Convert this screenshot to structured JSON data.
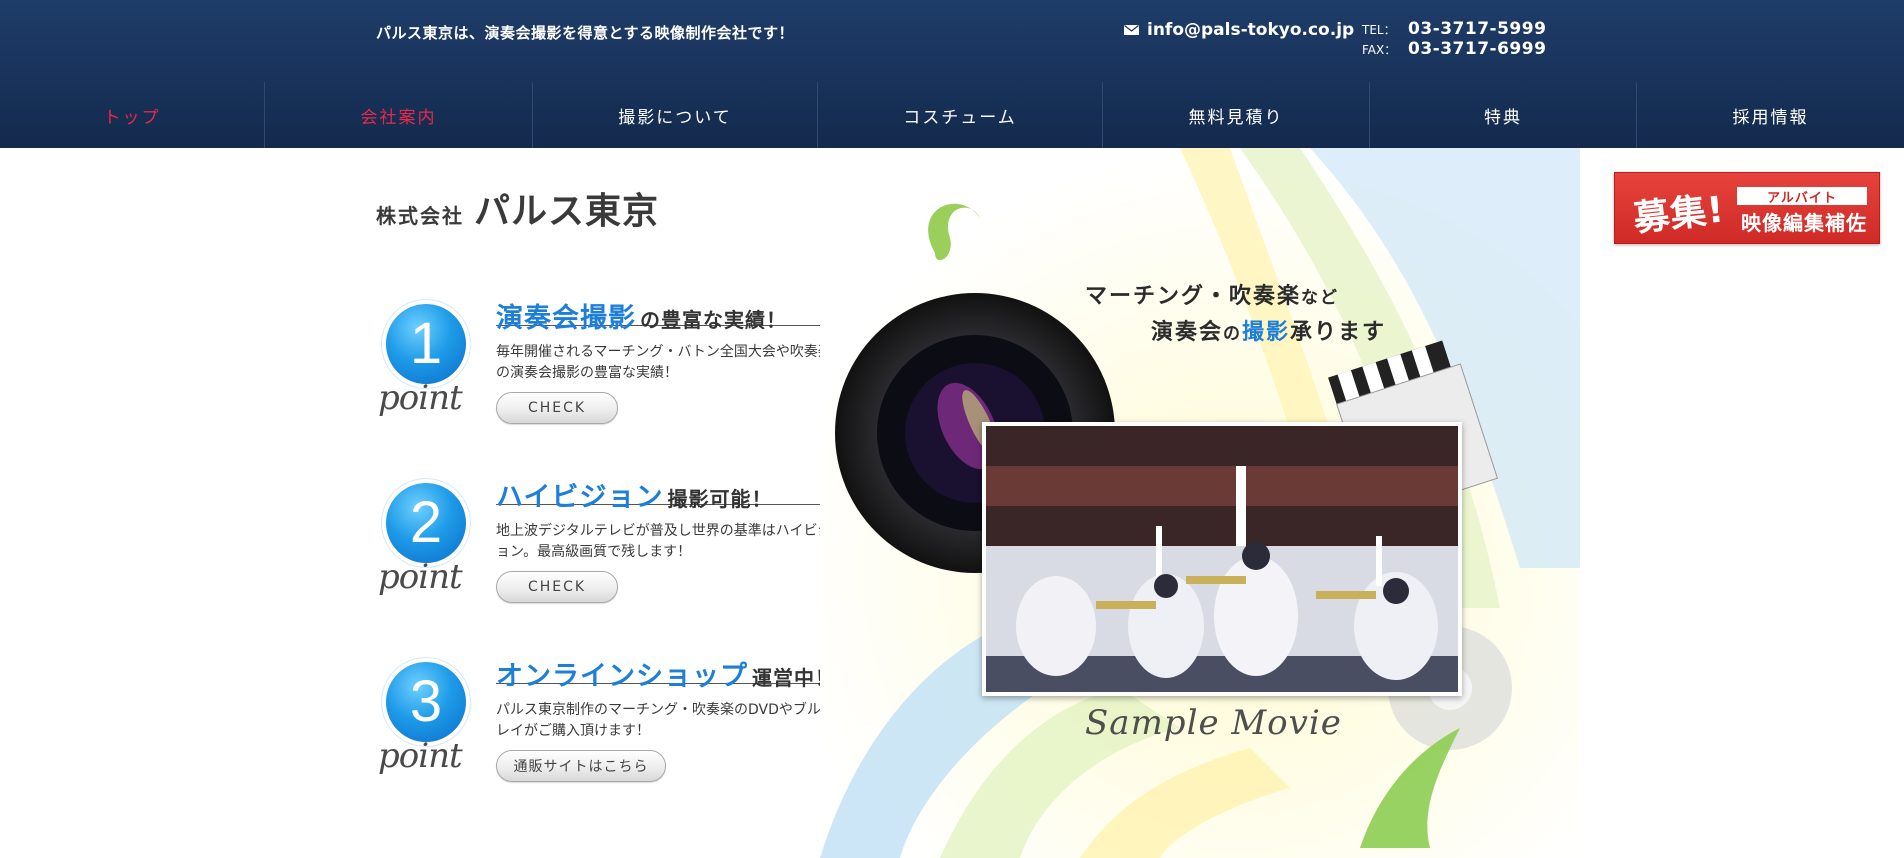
{
  "header": {
    "tagline": "パルス東京は、演奏会撮影を得意とする映像制作会社です！",
    "email": "info@pals-tokyo.co.jp",
    "tel_label": "TEL：",
    "tel": "03-3717-5999",
    "fax_label": "FAX：",
    "fax": "03-3717-6999",
    "icons": [
      "mail-icon"
    ]
  },
  "nav": {
    "items": [
      {
        "label": "トップ",
        "active": true
      },
      {
        "label": "会社案内",
        "active": true
      },
      {
        "label": "撮影について",
        "active": false
      },
      {
        "label": "コスチューム",
        "active": false
      },
      {
        "label": "無料見積り",
        "active": false
      },
      {
        "label": "特典",
        "active": false
      },
      {
        "label": "採用情報",
        "active": false
      }
    ],
    "active_color": "#e8284a"
  },
  "logo": {
    "small": "株式会社",
    "big": "パルス東京"
  },
  "points": [
    {
      "number": "1",
      "script": "point",
      "title_accent": "演奏会撮影",
      "title_rest": "の豊富な実績！",
      "desc": "毎年開催されるマーチング・バトン全国大会や吹奏楽の演奏会撮影の豊富な実績！",
      "button": "CHECK"
    },
    {
      "number": "2",
      "script": "point",
      "title_accent": "ハイビジョン",
      "title_rest": "撮影可能！",
      "desc": "地上波デジタルテレビが普及し世界の基準はハイビジョン。最高級画質で残します！",
      "button": "CHECK"
    },
    {
      "number": "3",
      "script": "point",
      "title_accent": "オンラインショップ",
      "title_rest": "運営中！",
      "desc": "パルス東京制作のマーチング・吹奏楽のDVDやブルーレイがご購入頂けます！",
      "button": "通販サイトはこちら"
    }
  ],
  "hero": {
    "line1_main": "マーチング・吹奏楽",
    "line1_small": "など",
    "line2_pre": "演奏会",
    "line2_small": "の",
    "line2_accent": "撮影",
    "line2_post": "承ります",
    "caption": "Sample Movie"
  },
  "recruit": {
    "main": "募集!",
    "tag": "アルバイト",
    "sub": "映像編集補佐"
  },
  "colors": {
    "header_bg": "#1a365f",
    "accent_blue": "#1d7fd8",
    "recruit_red": "#d6302b"
  }
}
